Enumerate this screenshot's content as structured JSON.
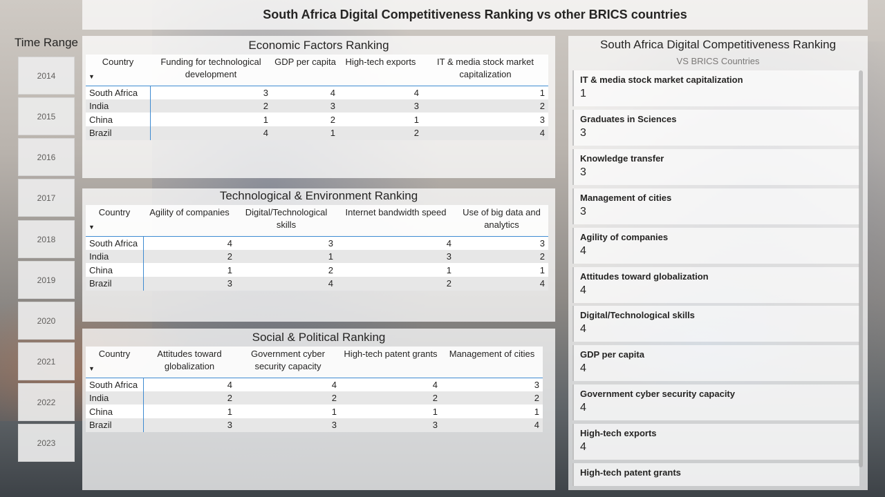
{
  "page_title": "South Africa Digital Competitiveness Ranking vs other BRICS countries",
  "time_range": {
    "label": "Time Range",
    "years": [
      "2014",
      "2015",
      "2016",
      "2017",
      "2018",
      "2019",
      "2020",
      "2021",
      "2022",
      "2023"
    ]
  },
  "economic": {
    "title": "Economic Factors Ranking",
    "headers": [
      "Country",
      "Funding for technological development",
      "GDP per capita",
      "High-tech exports",
      "IT & media stock market capitalization"
    ],
    "rows": [
      [
        "South Africa",
        "3",
        "4",
        "4",
        "1"
      ],
      [
        "India",
        "2",
        "3",
        "3",
        "2"
      ],
      [
        "China",
        "1",
        "2",
        "1",
        "3"
      ],
      [
        "Brazil",
        "4",
        "1",
        "2",
        "4"
      ]
    ]
  },
  "technological": {
    "title": "Technological & Environment Ranking",
    "headers": [
      "Country",
      "Agility of companies",
      "Digital/Technological skills",
      "Internet bandwidth speed",
      "Use of big data and analytics"
    ],
    "rows": [
      [
        "South Africa",
        "4",
        "3",
        "4",
        "3"
      ],
      [
        "India",
        "2",
        "1",
        "3",
        "2"
      ],
      [
        "China",
        "1",
        "2",
        "1",
        "1"
      ],
      [
        "Brazil",
        "3",
        "4",
        "2",
        "4"
      ]
    ]
  },
  "social": {
    "title": "Social & Political Ranking",
    "headers": [
      "Country",
      "Attitudes toward globalization",
      "Government cyber security capacity",
      "High-tech patent grants",
      "Management of cities"
    ],
    "rows": [
      [
        "South Africa",
        "4",
        "4",
        "4",
        "3"
      ],
      [
        "India",
        "2",
        "2",
        "2",
        "2"
      ],
      [
        "China",
        "1",
        "1",
        "1",
        "1"
      ],
      [
        "Brazil",
        "3",
        "3",
        "3",
        "4"
      ]
    ]
  },
  "ranking_panel": {
    "title": "South Africa Digital Competitiveness Ranking",
    "subtitle": "VS BRICS Countries",
    "cards": [
      {
        "label": "IT & media stock market capitalization",
        "value": "1"
      },
      {
        "label": "Graduates in Sciences",
        "value": "3"
      },
      {
        "label": "Knowledge transfer",
        "value": "3"
      },
      {
        "label": "Management of cities",
        "value": "3"
      },
      {
        "label": "Agility of companies",
        "value": "4"
      },
      {
        "label": "Attitudes toward globalization",
        "value": "4"
      },
      {
        "label": "Digital/Technological skills",
        "value": "4"
      },
      {
        "label": "GDP per capita",
        "value": "4"
      },
      {
        "label": "Government cyber security capacity",
        "value": "4"
      },
      {
        "label": "High-tech exports",
        "value": "4"
      },
      {
        "label": "High-tech patent grants",
        "value": ""
      }
    ]
  }
}
